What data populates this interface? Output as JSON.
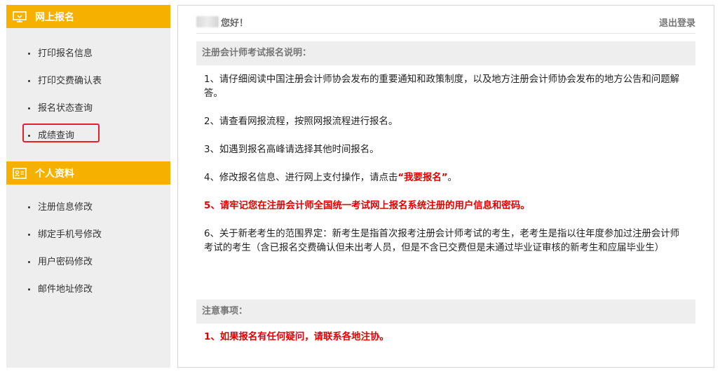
{
  "sidebar": {
    "sections": [
      {
        "title": "网上报名",
        "icon": "monitor-icon",
        "items": [
          {
            "label": "打印报名信息"
          },
          {
            "label": "打印交费确认表"
          },
          {
            "label": "报名状态查询"
          },
          {
            "label": "成绩查询",
            "highlighted": true
          }
        ]
      },
      {
        "title": "个人资料",
        "icon": "id-card-icon",
        "items": [
          {
            "label": "注册信息修改"
          },
          {
            "label": "绑定手机号修改"
          },
          {
            "label": "用户密码修改"
          },
          {
            "label": "邮件地址修改"
          }
        ]
      }
    ]
  },
  "header": {
    "greeting": "您好！",
    "logout_label": "退出登录"
  },
  "instructions": {
    "title": "注册会计师考试报名说明：",
    "items": [
      {
        "text": "1、请仔细阅读中国注册会计师协会发布的重要通知和政策制度，以及地方注册会计师协会发布的地方公告和问题解答。"
      },
      {
        "text": "2、请查看网报流程，按照网报流程进行报名。"
      },
      {
        "text": "3、如遇到报名高峰请选择其他时间报名。"
      },
      {
        "text_before": "4、修改报名信息、进行网上支付操作，请点击",
        "link": "“我要报名”",
        "text_after": "。"
      },
      {
        "text": "5、请牢记您在注册会计师全国统一考试网上报名系统注册的用户信息和密码。"
      },
      {
        "text": "6、关于新老考生的范围界定：新考生是指首次报考注册会计师考试的考生，老考生是指以往年度参加过注册会计师考试的考生（含已报名交费确认但未出考人员，但是不含已交费但是未通过毕业证审核的新考生和应届毕业生）"
      }
    ]
  },
  "notes": {
    "title": "注意事项：",
    "items": [
      {
        "text": "1、如果报名有任何疑问，请联系各地注协。"
      }
    ]
  },
  "colors": {
    "accent": "#f6b100",
    "sidebar_bg": "#eeeeee",
    "highlight_border": "#e52222",
    "warning_text": "#e50000"
  }
}
